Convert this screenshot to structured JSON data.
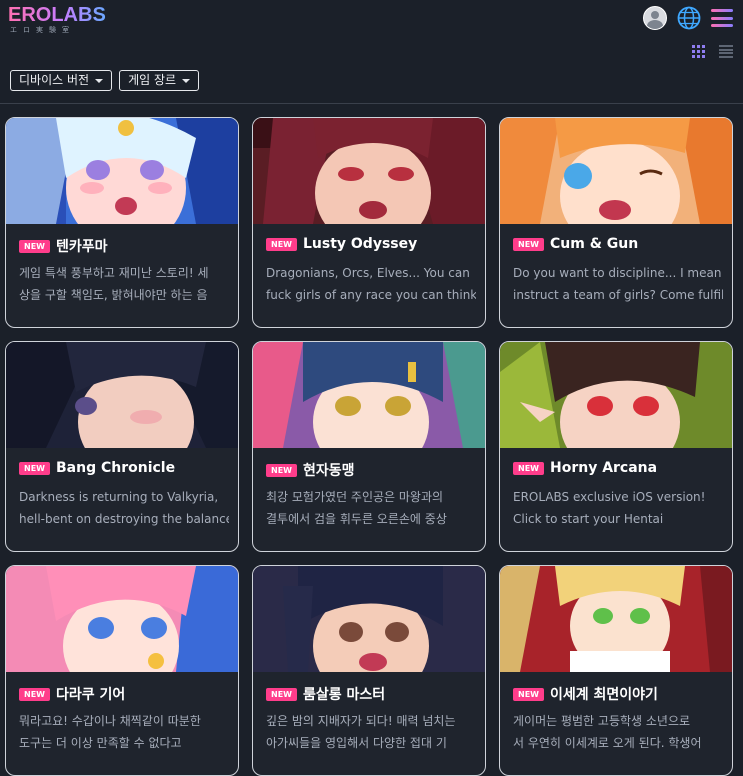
{
  "header": {
    "logo_text": "EROLABS",
    "logo_subtext": "エロ実験室"
  },
  "icons": {
    "avatar": "user-avatar-icon",
    "globe": "globe-icon",
    "menu": "hamburger-menu-icon",
    "grid_view": "grid-view-icon",
    "list_view": "list-view-icon"
  },
  "filters": {
    "device": "디바이스 버전",
    "genre": "게임 장르"
  },
  "colors": {
    "background": "#1b2029",
    "badge": "#ff3d8b",
    "accent": "#8f7df0"
  },
  "badge_label": "NEW",
  "games": [
    {
      "title": "텐카푸마",
      "desc1": "게임 특색 풍부하고 재미난 스토리! 세",
      "desc2": "상을 구할 책임도, 밝혀내야만 하는 음"
    },
    {
      "title": "Lusty Odyssey",
      "desc1": "Dragonians, Orcs, Elves... You can",
      "desc2": "fuck girls of any race you can think"
    },
    {
      "title": "Cum & Gun",
      "desc1": "Do you want to discipline... I mean",
      "desc2": "instruct a team of girls? Come fulfill"
    },
    {
      "title": "Bang Chronicle",
      "desc1": "Darkness is returning to Valkyria,",
      "desc2": "hell-bent on destroying the balance"
    },
    {
      "title": "현자동맹",
      "desc1": "최강 모험가였던 주인공은 마왕과의",
      "desc2": "결투에서 검을 휘두른 오른손에 중상"
    },
    {
      "title": "Horny Arcana",
      "desc1": "EROLABS exclusive iOS version!",
      "desc2": "Click to start your Hentai"
    },
    {
      "title": "다라쿠 기어",
      "desc1": "뭐라고요! 수갑이나 채찍같이 따분한",
      "desc2": "도구는 더 이상 만족할 수 없다고"
    },
    {
      "title": "룸살롱 마스터",
      "desc1": "깊은 밤의 지배자가 되다! 매력 넘치는",
      "desc2": "아가씨들을 영입해서 다양한 접대 기"
    },
    {
      "title": "이세계 최면이야기",
      "desc1": "게이머는 평범한 고등학생 소년으로",
      "desc2": "서 우연히 이세계로 오게 된다. 학생어"
    }
  ]
}
